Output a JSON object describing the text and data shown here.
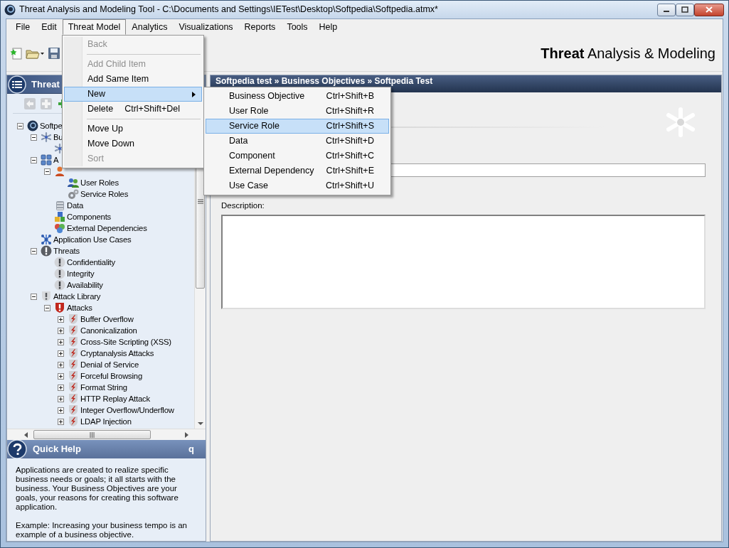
{
  "window": {
    "title": "Threat Analysis and Modeling Tool - C:\\Documents and Settings\\IETest\\Desktop\\Softpedia\\Softpedia.atmx*"
  },
  "menu": [
    {
      "label": "File",
      "selected": false
    },
    {
      "label": "Edit",
      "selected": false
    },
    {
      "label": "Threat Model",
      "selected": true
    },
    {
      "label": "Analytics",
      "selected": false
    },
    {
      "label": "Visualizations",
      "selected": false
    },
    {
      "label": "Reports",
      "selected": false
    },
    {
      "label": "Tools",
      "selected": false
    },
    {
      "label": "Help",
      "selected": false
    }
  ],
  "dropdown": {
    "items": [
      {
        "kind": "item",
        "label": "Back",
        "disabled": true,
        "selected": false
      },
      {
        "kind": "separator"
      },
      {
        "kind": "item",
        "label": "Add Child Item",
        "disabled": true,
        "selected": false
      },
      {
        "kind": "item",
        "label": "Add Same Item",
        "disabled": false,
        "selected": false
      },
      {
        "kind": "submenu",
        "label": "New",
        "disabled": false,
        "selected": true
      },
      {
        "kind": "item",
        "label": "Delete",
        "shortcut": "Ctrl+Shift+Del",
        "disabled": false,
        "selected": false
      },
      {
        "kind": "separator"
      },
      {
        "kind": "item",
        "label": "Move Up",
        "disabled": false,
        "selected": false
      },
      {
        "kind": "item",
        "label": "Move Down",
        "disabled": false,
        "selected": false
      },
      {
        "kind": "item",
        "label": "Sort",
        "disabled": true,
        "selected": false
      }
    ]
  },
  "submenu": {
    "items": [
      {
        "label": "Business Objective",
        "shortcut": "Ctrl+Shift+B",
        "selected": false
      },
      {
        "label": "User Role",
        "shortcut": "Ctrl+Shift+R",
        "selected": false
      },
      {
        "label": "Service Role",
        "shortcut": "Ctrl+Shift+S",
        "selected": true
      },
      {
        "label": "Data",
        "shortcut": "Ctrl+Shift+D",
        "selected": false
      },
      {
        "label": "Component",
        "shortcut": "Ctrl+Shift+C",
        "selected": false
      },
      {
        "label": "External Dependency",
        "shortcut": "Ctrl+Shift+E",
        "selected": false
      },
      {
        "label": "Use Case",
        "shortcut": "Ctrl+Shift+U",
        "selected": false
      }
    ]
  },
  "app_header": "**Threat** Analysis & Modeling",
  "explorer": {
    "title": "Threat",
    "tree": [
      {
        "label": "Softpe",
        "kind": "root",
        "expanded": true,
        "children": [
          {
            "label": "Bu",
            "kind": "objective",
            "expanded": true,
            "children": [
              {
                "kind": "objective"
              }
            ]
          },
          {
            "label": "A",
            "kind": "group",
            "expanded": true,
            "children": [
              {
                "kind": "role",
                "expanded": true,
                "children": [
                  {
                    "label": "User Roles",
                    "kind": "users"
                  },
                  {
                    "label": "Service Roles",
                    "kind": "gears"
                  }
                ]
              },
              {
                "label": "Data",
                "kind": "data"
              },
              {
                "label": "Components",
                "kind": "components"
              },
              {
                "label": "External Dependencies",
                "kind": "external"
              }
            ]
          },
          {
            "label": "Application Use Cases",
            "kind": "usecase"
          },
          {
            "label": "Threats",
            "kind": "threat",
            "expanded": true,
            "children": [
              {
                "label": "Confidentiality",
                "kind": "alert"
              },
              {
                "label": "Integrity",
                "kind": "alert"
              },
              {
                "label": "Availability",
                "kind": "alert"
              }
            ]
          },
          {
            "label": "Attack Library",
            "kind": "library",
            "expanded": true,
            "children": [
              {
                "label": "Attacks",
                "kind": "attackgroup",
                "expanded": true,
                "children": [
                  {
                    "label": "Buffer Overflow",
                    "kind": "attack",
                    "expanded": false
                  },
                  {
                    "label": "Canonicalization",
                    "kind": "attack",
                    "expanded": false
                  },
                  {
                    "label": "Cross-Site Scripting (XSS)",
                    "kind": "attack",
                    "expanded": false
                  },
                  {
                    "label": "Cryptanalysis Attacks",
                    "kind": "attack",
                    "expanded": false
                  },
                  {
                    "label": "Denial of Service",
                    "kind": "attack",
                    "expanded": false
                  },
                  {
                    "label": "Forceful Browsing",
                    "kind": "attack",
                    "expanded": false
                  },
                  {
                    "label": "Format String",
                    "kind": "attack",
                    "expanded": false
                  },
                  {
                    "label": "HTTP Replay Attack",
                    "kind": "attack",
                    "expanded": false
                  },
                  {
                    "label": "Integer Overflow/Underflow",
                    "kind": "attack",
                    "expanded": false
                  },
                  {
                    "label": "LDAP Injection",
                    "kind": "attack",
                    "expanded": false
                  }
                ]
              }
            ]
          }
        ]
      }
    ]
  },
  "breadcrumb": "Softpedia test » Business Objectives » Softpedia Test",
  "form": {
    "description_label": "Description:"
  },
  "quick_help": {
    "title": "Quick Help",
    "shortcut": "q",
    "paragraphs": [
      "Applications are created to realize specific business needs or goals; it all starts with the business. Your Business Objectives are your goals, your reasons for creating this software application.",
      "Example: Increasing your business tempo is an example of a business objective."
    ]
  }
}
